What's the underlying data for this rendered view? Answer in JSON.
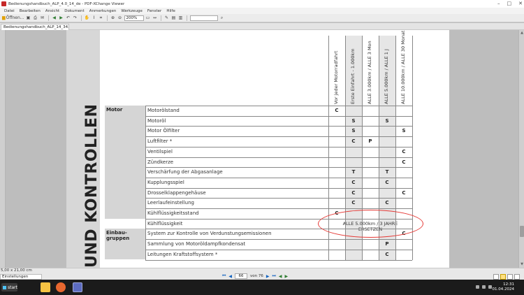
{
  "window": {
    "title": "Bedienungshandbuch_ALP_4.0_14_de - PDF-XChange Viewer",
    "controls": [
      "–",
      "□",
      "✕"
    ]
  },
  "menu": [
    "Datei",
    "Bearbeiten",
    "Ansicht",
    "Dokument",
    "Anmerkungen",
    "Werkzeuge",
    "Fenster",
    "Hilfe"
  ],
  "toolbar": {
    "open_label": "Öffnen...",
    "zoom_value": "200%"
  },
  "tab": {
    "label": "Bedienungshandbuch_ALP_14_34..."
  },
  "page": {
    "side_title": "UND KONTROLLEN",
    "columns": [
      "Vor jeder Motorradfahrt",
      "Erste Einfahrt - 1.000km",
      "ALLE 3.000km / ALLE 3 Mon",
      "ALLE 5.000km / ALLE 1 J",
      "ALLE 10.000km / ALLE 30 Monate"
    ],
    "categories": [
      {
        "label": "Motor"
      },
      {
        "label": "Einbau-\ngruppen"
      }
    ],
    "rows": [
      {
        "label": "Motorölstand",
        "marks": [
          "C",
          "",
          "",
          "",
          ""
        ]
      },
      {
        "label": "Motoröl",
        "marks": [
          "",
          "S",
          "",
          "S",
          ""
        ]
      },
      {
        "label": "Motor Ölfilter",
        "marks": [
          "",
          "S",
          "",
          "",
          "S"
        ]
      },
      {
        "label": "Luftfilter *",
        "marks": [
          "",
          "C",
          "P",
          "",
          ""
        ]
      },
      {
        "label": "Ventilspiel",
        "marks": [
          "",
          "",
          "",
          "",
          "C"
        ]
      },
      {
        "label": "Zündkerze",
        "marks": [
          "",
          "",
          "",
          "",
          "C"
        ]
      },
      {
        "label": "Verschärfung der Abgasanlage",
        "marks": [
          "",
          "T",
          "",
          "T",
          ""
        ]
      },
      {
        "label": "Kupplungsspiel",
        "marks": [
          "",
          "C",
          "",
          "C",
          ""
        ]
      },
      {
        "label": "Drosselklappengehäuse",
        "marks": [
          "",
          "C",
          "",
          "",
          "C"
        ]
      },
      {
        "label": "Leerlaufeinstellung",
        "marks": [
          "",
          "C",
          "",
          "C",
          ""
        ]
      },
      {
        "label": "Kühlflüssigkeitsstand",
        "marks": [
          "C",
          "",
          "",
          "",
          ""
        ]
      },
      {
        "label": "Kühlflüssigkeit",
        "marks": [
          "",
          "",
          "",
          "",
          ""
        ],
        "merged": "ALLE 5.000km / 3 JAHRE\nERSETZEN"
      },
      {
        "label": "System zur Kontrolle von Verdunstungsemissionen",
        "marks": [
          "",
          "",
          "",
          "",
          "C"
        ]
      },
      {
        "label": "Sammlung von Motoröldampfkondensat",
        "marks": [
          "",
          "",
          "",
          "P",
          ""
        ]
      },
      {
        "label": "Leitungen Kraftstoffsystem *",
        "marks": [
          "",
          "",
          "",
          "C",
          ""
        ]
      }
    ]
  },
  "status": {
    "page_size": "5,00 x 21,00 cm",
    "nav_label": "Einstellungen",
    "current_page": "66",
    "page_of": "von 76"
  },
  "taskbar": {
    "start_label": "start",
    "time": "12:31",
    "date": "01.04.2024"
  },
  "colors": {
    "annotation_circle": "#e53935",
    "accent": "#1565c0"
  }
}
